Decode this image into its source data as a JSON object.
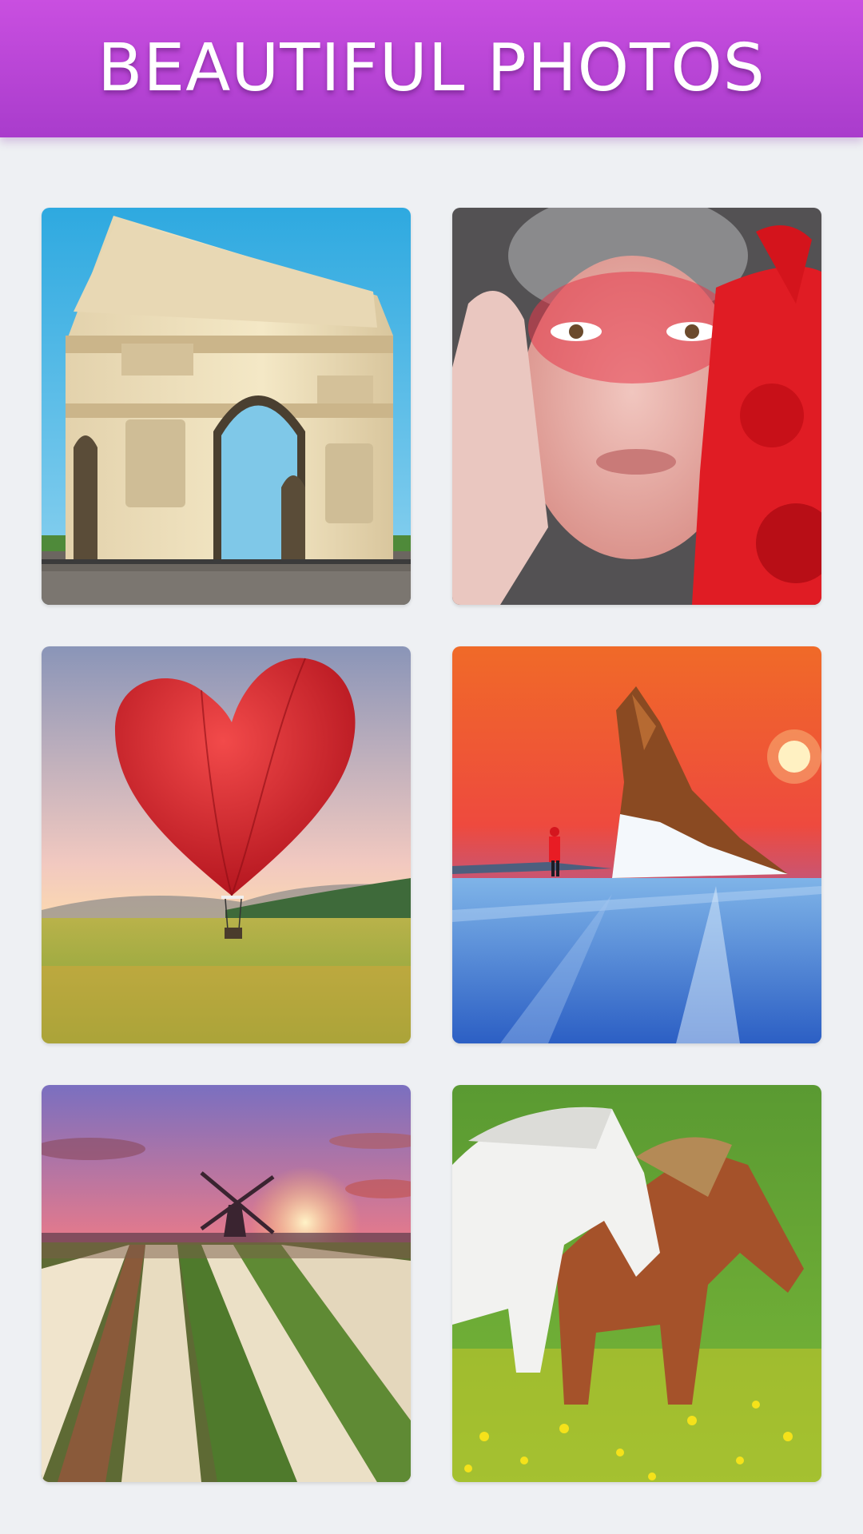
{
  "header": {
    "title": "BEAUTIFUL PHOTOS",
    "gradient_top": "#c94fe0",
    "gradient_bottom": "#a93ccc"
  },
  "photos": [
    {
      "subject": "arc-de-triomphe",
      "icon": "arc-de-triomphe-photo"
    },
    {
      "subject": "red-face-paint-portrait",
      "icon": "portrait-photo"
    },
    {
      "subject": "heart-hot-air-balloon",
      "icon": "balloon-photo"
    },
    {
      "subject": "ice-rock-sunset",
      "icon": "ice-rock-photo"
    },
    {
      "subject": "windmill-tulip-field",
      "icon": "windmill-photo"
    },
    {
      "subject": "white-and-brown-horses",
      "icon": "horses-photo"
    }
  ]
}
